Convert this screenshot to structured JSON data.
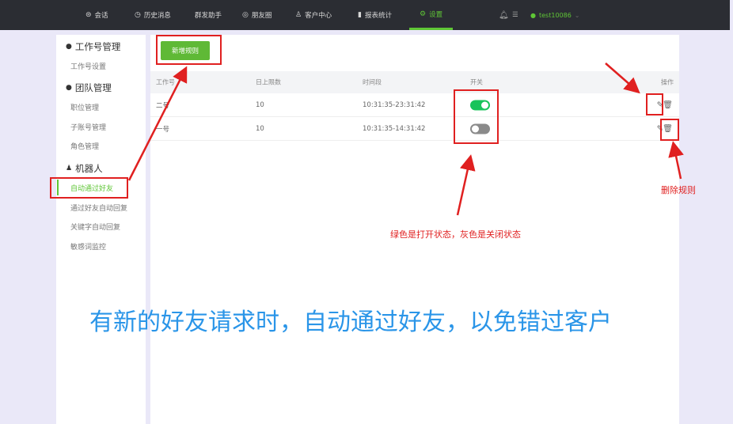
{
  "topbar": {
    "nav": [
      {
        "icon": "chat-icon",
        "label": "会话"
      },
      {
        "icon": "clock-icon",
        "label": "历史消息"
      },
      {
        "icon": "",
        "label": "群发助手"
      },
      {
        "icon": "moments-icon",
        "label": "朋友圈"
      },
      {
        "icon": "user-icon",
        "label": "客户中心"
      },
      {
        "icon": "bar-chart-icon",
        "label": "报表统计"
      },
      {
        "icon": "gear-icon",
        "label": "设置"
      }
    ],
    "username": "test10086"
  },
  "sidebar": {
    "groups": [
      {
        "label": "工作号管理",
        "items": [
          "工作号设置"
        ]
      },
      {
        "label": "团队管理",
        "items": [
          "职位管理",
          "子账号管理",
          "角色管理"
        ]
      },
      {
        "label": "机器人",
        "items": [
          "自动通过好友",
          "通过好友自动回复",
          "关键字自动回复",
          "敏感词监控"
        ]
      }
    ]
  },
  "main": {
    "add_button": "新增规则",
    "columns": [
      "工作号",
      "日上限数",
      "时间段",
      "开关",
      "操作"
    ],
    "rows": [
      {
        "account": "二号",
        "limit": "10",
        "time": "10:31:35-23:31:42",
        "enabled": true
      },
      {
        "account": "一号",
        "limit": "10",
        "time": "10:31:35-14:31:42",
        "enabled": false
      }
    ]
  },
  "annotations": {
    "delete_label": "删除规则",
    "switch_note": "绿色是打开状态，灰色是关闭状态",
    "caption": "有新的好友请求时，自动通过好友，以免错过客户"
  },
  "colors": {
    "accent": "#5fc636",
    "annotation": "#e02020",
    "caption": "#2a95e8"
  }
}
